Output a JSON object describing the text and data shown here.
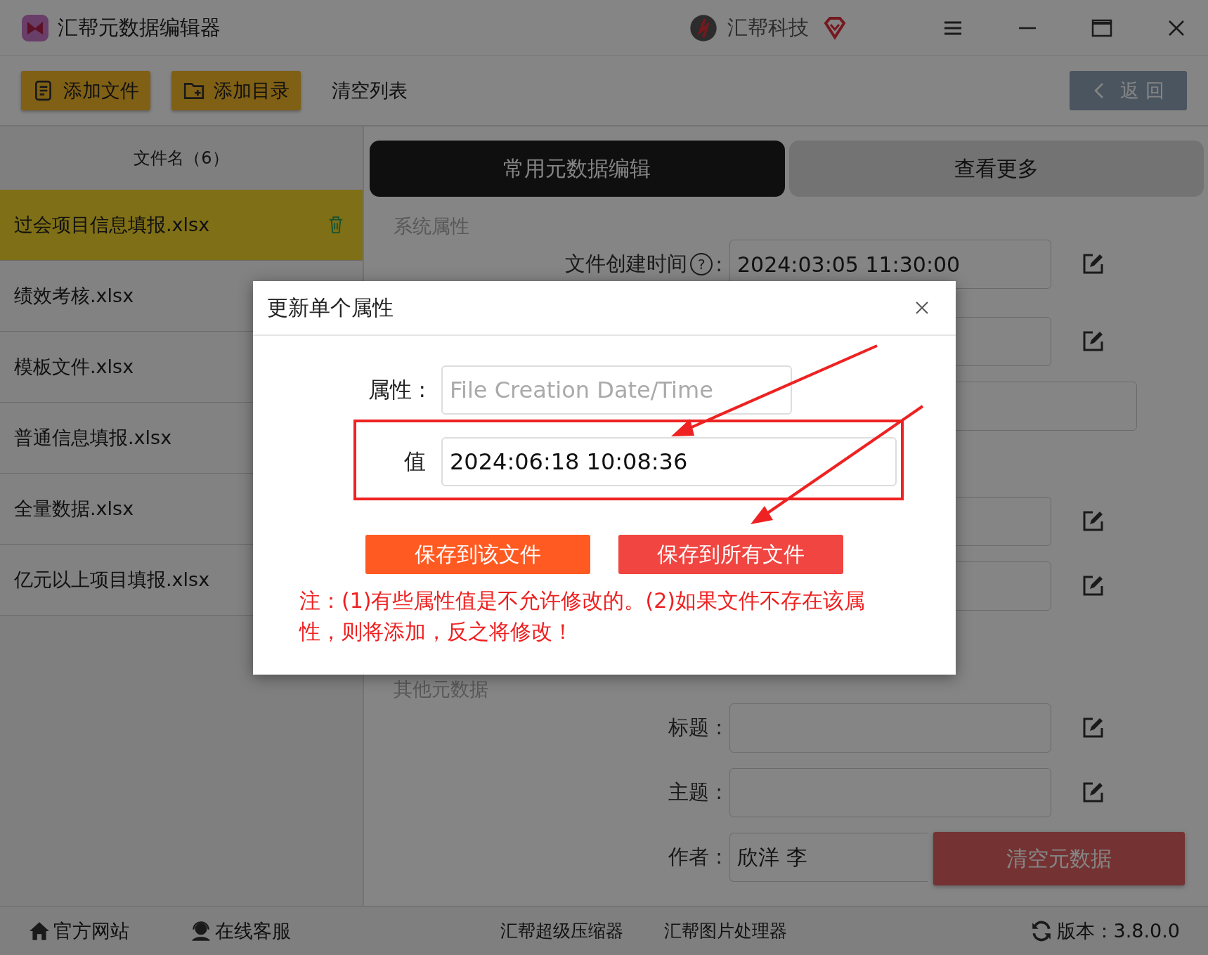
{
  "window": {
    "title": "汇帮元数据编辑器",
    "brand": "汇帮科技"
  },
  "toolbar": {
    "buttons": [
      {
        "label": "添加文件",
        "kind": "file"
      },
      {
        "label": "添加目录",
        "kind": "folder"
      },
      {
        "label": "清空列表",
        "kind": "plain"
      }
    ],
    "back_button": "返 回"
  },
  "file_list": {
    "header": "文件名（6）",
    "items": [
      {
        "name": "过会项目信息填报.xlsx",
        "selected": true
      },
      {
        "name": "绩效考核.xlsx",
        "selected": false
      },
      {
        "name": "模板文件.xlsx",
        "selected": false
      },
      {
        "name": "普通信息填报.xlsx",
        "selected": false
      },
      {
        "name": "全量数据.xlsx",
        "selected": false
      },
      {
        "name": "亿元以上项目填报.xlsx",
        "selected": false
      }
    ]
  },
  "tabs": [
    {
      "label": "常用元数据编辑",
      "selected": true
    },
    {
      "label": "查看更多",
      "selected": false
    }
  ],
  "sections": [
    {
      "title": "系统属性",
      "rows": [
        {
          "kind": "field",
          "label": "文件创建时间",
          "help": "?",
          "suffix": ":",
          "value": "2024:03:05 11:30:00",
          "edit": true
        },
        {
          "kind": "field",
          "edit": true
        },
        {
          "kind": "wide",
          "edit": false
        },
        {
          "kind": "field",
          "edit": true,
          "gap": true
        },
        {
          "kind": "field",
          "edit": true
        }
      ]
    },
    {
      "title": "其他元数据",
      "rows": [
        {
          "kind": "field",
          "label": "标题 :",
          "edit": true
        },
        {
          "kind": "field",
          "label": "主题 :",
          "edit": true
        },
        {
          "kind": "short",
          "label": "作者 :",
          "value": "欣洋 李",
          "edit": false
        }
      ]
    }
  ],
  "clear_button": "清空元数据",
  "footer": {
    "links": [
      {
        "label": "官方网站",
        "kind": "home"
      },
      {
        "label": "在线客服",
        "kind": "support"
      }
    ],
    "tools": [
      "汇帮超级压缩器",
      "汇帮图片处理器"
    ],
    "version": "版本：3.8.0.0"
  },
  "dialog": {
    "title": "更新单个属性",
    "property_label": "属性 :",
    "property_placeholder": "File Creation Date/Time",
    "value_label": "值",
    "value": "2024:06:18 10:08:36",
    "buttons": [
      {
        "label": "保存到该文件",
        "kind": "primary"
      },
      {
        "label": "保存到所有文件",
        "kind": "danger"
      }
    ],
    "note": "注：(1)有些属性值是不允许修改的。(2)如果文件不存在该属性，则将添加，反之将修改！"
  }
}
